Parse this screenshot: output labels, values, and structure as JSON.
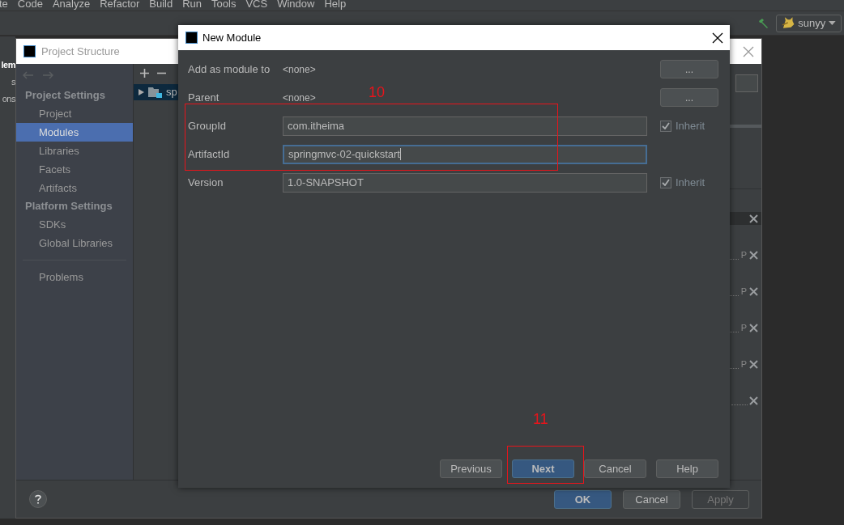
{
  "menu_bar": {
    "items": [
      "te",
      "Code",
      "Analyze",
      "Refactor",
      "Build",
      "Run",
      "Tools",
      "VCS",
      "Window",
      "Help"
    ]
  },
  "toolbar": {
    "run_config": "sunyy"
  },
  "ide_sidebar": {
    "fragments": [
      "lem",
      "s",
      "ons"
    ]
  },
  "project_structure": {
    "title": "Project Structure",
    "sections": [
      {
        "heading": "Project Settings",
        "items": [
          {
            "label": "Project",
            "selected": false
          },
          {
            "label": "Modules",
            "selected": true
          },
          {
            "label": "Libraries",
            "selected": false
          },
          {
            "label": "Facets",
            "selected": false
          },
          {
            "label": "Artifacts",
            "selected": false
          }
        ]
      },
      {
        "heading": "Platform Settings",
        "items": [
          {
            "label": "SDKs",
            "selected": false
          },
          {
            "label": "Global Libraries",
            "selected": false
          }
        ]
      }
    ],
    "footer_items": [
      {
        "label": "Problems",
        "selected": false
      }
    ],
    "tree": [
      {
        "label": "sp",
        "selected": true,
        "expanded": false
      }
    ],
    "right_rows": [
      {
        "kind": "header"
      },
      {
        "kind": "path",
        "label": "P"
      },
      {
        "kind": "path",
        "label": "P"
      },
      {
        "kind": "path",
        "label": "P"
      },
      {
        "kind": "path",
        "label": "P"
      },
      {
        "kind": "plain"
      }
    ],
    "buttons": [
      {
        "label": "OK",
        "kind": "primary"
      },
      {
        "label": "Cancel",
        "kind": "normal"
      },
      {
        "label": "Apply",
        "kind": "disabled"
      }
    ]
  },
  "new_module": {
    "title": "New Module",
    "fields": [
      {
        "label": "Add as module to",
        "kind": "static",
        "value": "<none>",
        "button": "..."
      },
      {
        "label": "Parent",
        "kind": "static",
        "value": "<none>",
        "button": "..."
      },
      {
        "label": "GroupId",
        "kind": "input",
        "value": "com.itheima",
        "focused": false,
        "inherit": {
          "label": "Inherit",
          "checked": true
        }
      },
      {
        "label": "ArtifactId",
        "kind": "input",
        "value": "springmvc-02-quickstart",
        "focused": true
      },
      {
        "label": "Version",
        "kind": "input",
        "value": "1.0-SNAPSHOT",
        "focused": false,
        "inherit": {
          "label": "Inherit",
          "checked": true
        }
      }
    ],
    "buttons": [
      {
        "label": "Previous",
        "kind": "normal"
      },
      {
        "label": "Next",
        "kind": "primary"
      },
      {
        "label": "Cancel",
        "kind": "normal"
      },
      {
        "label": "Help",
        "kind": "normal"
      }
    ]
  },
  "annotations": [
    {
      "text": "10"
    },
    {
      "text": "11"
    }
  ]
}
